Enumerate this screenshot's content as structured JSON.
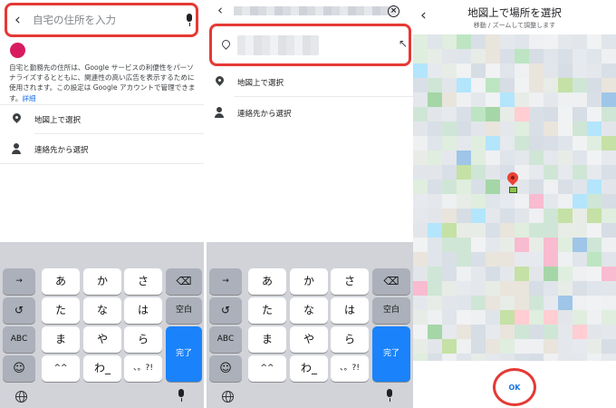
{
  "panel1": {
    "search_placeholder": "自宅の住所を入力",
    "info_text": "自宅と勤務先の住所は、Google サービスの利便性をパーソナライズするとともに、関連性の高い広告を表示するために使用されます。この設定は Google アカウントで管理できます。",
    "info_link": "詳細",
    "option_map": "地図上で選択",
    "option_contacts": "連絡先から選択"
  },
  "panel2": {
    "option_map": "地図上で選択",
    "option_contacts": "連絡先から選択"
  },
  "panel3": {
    "title": "地図上で場所を選択",
    "subtitle": "移動 / ズームして調整します",
    "ok_label": "OK"
  },
  "keyboard": {
    "arrow": "→",
    "undo": "↺",
    "abc": "ABC",
    "emoji": "☺",
    "backspace": "⌫",
    "space": "空白",
    "done": "完了",
    "rows": [
      [
        "あ",
        "か",
        "さ"
      ],
      [
        "た",
        "な",
        "は"
      ],
      [
        "ま",
        "や",
        "ら"
      ],
      [
        "^^",
        "わ_",
        "、。?!"
      ]
    ]
  },
  "colors": {
    "highlight": "#e53935",
    "accent": "#1a73e8",
    "done_key": "#1a82fb",
    "avatar": "#d81b60",
    "marker": "#ea4335"
  },
  "icons": [
    "back-icon",
    "mic-icon",
    "pin-icon",
    "person-icon",
    "clear-icon",
    "north-west-arrow-icon",
    "globe-icon",
    "backspace-icon"
  ]
}
